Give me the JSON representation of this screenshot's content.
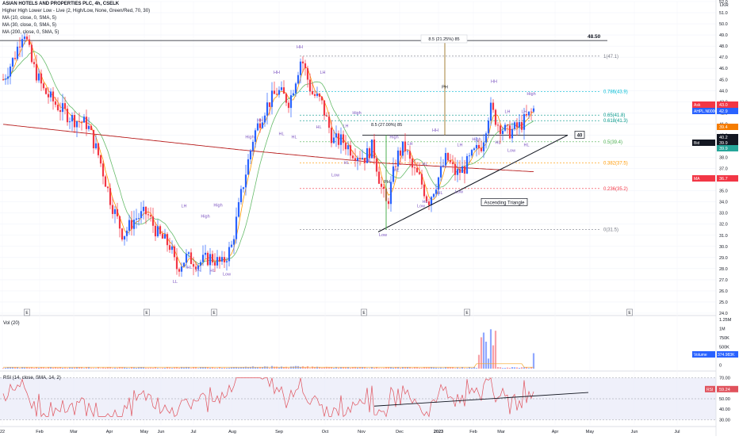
{
  "header": {
    "title": "ASIAN HOTELS AND PROPERTIES PLC, 4h, CSELK",
    "indicators": [
      "Higher High Lower Low - Live (2, High/Low, None, Green/Red, 70, 30)",
      "MA (10, close, 0, SMA, 5)",
      "MA (30, close, 0, SMA, 5)",
      "MA (200, close, 0, SMA, 5)"
    ],
    "currency": "LKR"
  },
  "colors": {
    "up": "#2962ff",
    "down": "#f23645",
    "ma10": "#ff9800",
    "ma30": "#66bb6a",
    "ma200": "#b71c1c",
    "label": "#7e57c2",
    "fib_top": "#787b86",
    "fib_786": "#00bcd4",
    "fib_65": "#009688",
    "fib_5": "#4caf50",
    "fib_382": "#ff9800",
    "fib_236": "#f23645",
    "rsi": "#e0525c",
    "rsi_bg": "#e8eaf8",
    "vol_ma": "#f6a623"
  },
  "chart_data": {
    "type": "candlestick",
    "price_axis": {
      "ticks": [
        "52.0",
        "51.0",
        "50.0",
        "49.0",
        "48.0",
        "47.0",
        "46.0",
        "45.0",
        "44.0",
        "43.0",
        "42.0",
        "41.0",
        "40.0",
        "39.0",
        "38.0",
        "37.0",
        "36.0",
        "35.0",
        "34.0",
        "33.0",
        "32.0",
        "31.0",
        "30.0",
        "29.0",
        "28.0",
        "27.0",
        "26.0",
        "25.0",
        "24.0"
      ],
      "ylim": [
        24,
        52
      ]
    },
    "time_axis": {
      "labels": [
        "22",
        "Feb",
        "Mar",
        "Apr",
        "May",
        "Jun",
        "Jul",
        "Aug",
        "Sep",
        "Oct",
        "Nov",
        "Dec",
        "2023",
        "Feb",
        "Mar",
        "Apr",
        "May",
        "Jun",
        "Jul"
      ],
      "event_markers": [
        "E",
        "E",
        "E",
        "E",
        "E",
        "E"
      ]
    },
    "price_badges": {
      "ask": {
        "label": "Ask",
        "value": "43.0"
      },
      "symbol": {
        "label": "AHPL.N0000",
        "value": "42.9"
      },
      "bid": {
        "label": "Bid",
        "value": "39.9"
      },
      "ma": {
        "label": "MA",
        "value": "36.7"
      },
      "small": [
        "39.4",
        "40.2",
        "39.9"
      ]
    },
    "horizontal_levels": [
      {
        "label": "48.50",
        "value": 48.5
      },
      {
        "label": "40",
        "value": 40.0
      }
    ],
    "fibonacci": [
      {
        "label": "1(47.1)",
        "value": 47.1
      },
      {
        "label": "0.786(43.9)",
        "value": 43.9
      },
      {
        "label": "0.65(41.8)",
        "value": 41.8
      },
      {
        "label": "0.618(41.3)",
        "value": 41.3
      },
      {
        "label": "0.5(39.4)",
        "value": 39.4
      },
      {
        "label": "0.382(37.5)",
        "value": 37.5
      },
      {
        "label": "0.236(35.2)",
        "value": 35.2
      },
      {
        "label": "0(31.5)",
        "value": 31.5
      }
    ],
    "annotations": {
      "measure_top": "8.5 (21.25%) 85",
      "measure_mid": "8.5 (27.00%) 85",
      "pattern": "Ascending Triangle",
      "pivot_marker": "PH"
    },
    "swing_labels": [
      {
        "text": "LL",
        "x": 221,
        "price": 26.7
      },
      {
        "text": "HL",
        "x": 239,
        "price": 28.0
      },
      {
        "text": "LL",
        "x": 250,
        "price": 27.8
      },
      {
        "text": "HL",
        "x": 268,
        "price": 27.7
      },
      {
        "text": "Low",
        "x": 286,
        "price": 27.4
      },
      {
        "text": "LH",
        "x": 232,
        "price": 33.5
      },
      {
        "text": "High",
        "x": 259,
        "price": 32.6
      },
      {
        "text": "High",
        "x": 275,
        "price": 33.6
      },
      {
        "text": "High",
        "x": 315,
        "price": 39.7
      },
      {
        "text": "HH",
        "x": 328,
        "price": 41.2
      },
      {
        "text": "HH",
        "x": 349,
        "price": 45.5
      },
      {
        "text": "HH",
        "x": 378,
        "price": 47.8
      },
      {
        "text": "LH",
        "x": 407,
        "price": 45.5
      },
      {
        "text": "HL",
        "x": 355,
        "price": 40.0
      },
      {
        "text": "HL",
        "x": 371,
        "price": 39.7
      },
      {
        "text": "HL",
        "x": 402,
        "price": 40.6
      },
      {
        "text": "LH",
        "x": 436,
        "price": 40.7
      },
      {
        "text": "High",
        "x": 450,
        "price": 41.9
      },
      {
        "text": "Low",
        "x": 423,
        "price": 36.3
      },
      {
        "text": "HL",
        "x": 437,
        "price": 37.4
      },
      {
        "text": "HL",
        "x": 465,
        "price": 37.6
      },
      {
        "text": "High",
        "x": 497,
        "price": 39.7
      },
      {
        "text": "LH",
        "x": 517,
        "price": 39.1
      },
      {
        "text": "HH",
        "x": 549,
        "price": 40.3
      },
      {
        "text": "LH",
        "x": 580,
        "price": 39.0
      },
      {
        "text": "HL",
        "x": 536,
        "price": 37.3
      },
      {
        "text": "HL",
        "x": 500,
        "price": 36.7
      },
      {
        "text": "Low",
        "x": 531,
        "price": 33.5
      },
      {
        "text": "HL",
        "x": 555,
        "price": 34.7
      },
      {
        "text": "HL",
        "x": 536,
        "price": 33.9
      },
      {
        "text": "Low",
        "x": 579,
        "price": 34.8
      },
      {
        "text": "High",
        "x": 601,
        "price": 39.5
      },
      {
        "text": "HH",
        "x": 623,
        "price": 44.7
      },
      {
        "text": "LH",
        "x": 640,
        "price": 42.0
      },
      {
        "text": "LH",
        "x": 661,
        "price": 42.0
      },
      {
        "text": "High",
        "x": 670,
        "price": 43.6
      },
      {
        "text": "HL",
        "x": 628,
        "price": 39.2
      },
      {
        "text": "Low",
        "x": 645,
        "price": 38.5
      },
      {
        "text": "HL",
        "x": 664,
        "price": 39.0
      },
      {
        "text": "Low",
        "x": 483,
        "price": 30.9
      },
      {
        "text": "PH",
        "x": 561,
        "price": 44.2
      },
      {
        "text": "PH",
        "x": 488,
        "price": 35.7
      }
    ],
    "volume": {
      "title": "Vol (20)",
      "axis_ticks": [
        "1.25M",
        "1M",
        "750K",
        "500K",
        "250K",
        "0"
      ],
      "badge": {
        "label": "Volume",
        "value": "374.983K"
      },
      "ylim": [
        0,
        1250000
      ]
    },
    "rsi": {
      "title": "RSI (14, close, SMA, 14, 2)",
      "axis_ticks": [
        "70.00",
        "60.00",
        "50.00",
        "40.00",
        "30.00"
      ],
      "badge": {
        "label": "RSI",
        "value": "59.24"
      },
      "ylim": [
        25,
        75
      ],
      "band": [
        30,
        70
      ]
    }
  }
}
